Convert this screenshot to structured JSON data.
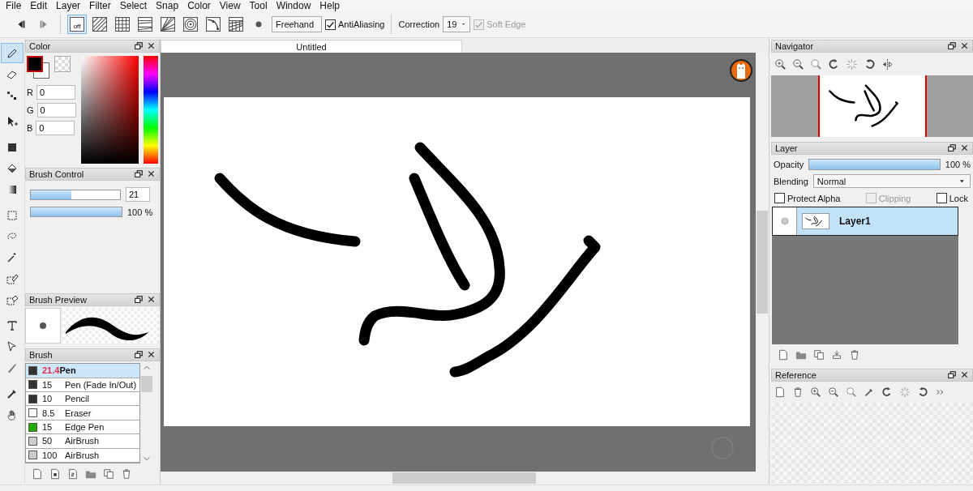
{
  "menu": [
    "File",
    "Edit",
    "Layer",
    "Filter",
    "Select",
    "Snap",
    "Color",
    "View",
    "Tool",
    "Window",
    "Help"
  ],
  "toolbar": {
    "snap_modes": [
      {
        "kind": "off",
        "label": "off",
        "selected": true
      },
      {
        "kind": "parallel",
        "selected": false
      },
      {
        "kind": "grid",
        "selected": false
      },
      {
        "kind": "lines",
        "selected": false
      },
      {
        "kind": "radial",
        "selected": false
      },
      {
        "kind": "concentric",
        "selected": false
      },
      {
        "kind": "curve",
        "selected": false
      },
      {
        "kind": "perspective",
        "selected": false
      }
    ],
    "stroke_mode": "Freehand",
    "antialiasing": {
      "label": "AntiAliasing",
      "checked": true
    },
    "correction": {
      "label": "Correction",
      "value": "19"
    },
    "soft_edge": {
      "label": "Soft Edge",
      "checked": true,
      "disabled": true
    }
  },
  "tools": [
    {
      "kind": "pen",
      "selected": true
    },
    {
      "kind": "eraser",
      "selected": false
    },
    {
      "kind": "dots",
      "selected": false
    },
    {
      "kind": "move",
      "selected": false
    },
    {
      "kind": "fill",
      "selected": false
    },
    {
      "kind": "bucket",
      "selected": false
    },
    {
      "kind": "gradient",
      "selected": false
    },
    {
      "kind": "select",
      "selected": false
    },
    {
      "kind": "lasso",
      "selected": false
    },
    {
      "kind": "wand",
      "selected": false
    },
    {
      "kind": "selpen",
      "selected": false
    },
    {
      "kind": "selerase",
      "selected": false
    },
    {
      "kind": "text",
      "selected": false
    },
    {
      "kind": "operation",
      "selected": false
    },
    {
      "kind": "divide",
      "selected": false
    },
    {
      "kind": "eyedropper",
      "selected": false
    },
    {
      "kind": "hand",
      "selected": false
    }
  ],
  "color_panel": {
    "title": "Color",
    "fields": [
      {
        "label": "R",
        "value": "0"
      },
      {
        "label": "G",
        "value": "0"
      },
      {
        "label": "B",
        "value": "0"
      }
    ]
  },
  "brush_control": {
    "title": "Brush Control",
    "size": {
      "level": 0.45,
      "value": "21"
    },
    "opacity": {
      "level": 1,
      "value": "100 %"
    }
  },
  "brush_preview": {
    "title": "Brush Preview"
  },
  "brush_panel": {
    "title": "Brush",
    "items": [
      {
        "size": "21.4",
        "name": "Pen",
        "color": "#333333",
        "selected": true
      },
      {
        "size": "15",
        "name": "Pen (Fade In/Out)",
        "color": "#333333",
        "selected": false
      },
      {
        "size": "10",
        "name": "Pencil",
        "color": "#333333",
        "selected": false
      },
      {
        "size": "8.5",
        "name": "Eraser",
        "color": "#ffffff",
        "selected": false
      },
      {
        "size": "15",
        "name": "Edge Pen",
        "color": "#22aa00",
        "selected": false
      },
      {
        "size": "50",
        "name": "AirBrush",
        "color": "#cccccc",
        "selected": false
      },
      {
        "size": "100",
        "name": "AirBrush",
        "color": "#cccccc",
        "selected": false
      }
    ]
  },
  "canvas": {
    "tab": "Untitled"
  },
  "navigator": {
    "title": "Navigator"
  },
  "layer_panel": {
    "title": "Layer",
    "opacity": {
      "label": "Opacity",
      "level": 1,
      "value": "100 %"
    },
    "blending_label": "Blending",
    "blending": "Normal",
    "options": [
      {
        "label": "Protect Alpha",
        "checked": false,
        "disabled": false
      },
      {
        "label": "Clipping",
        "checked": false,
        "disabled": true
      },
      {
        "label": "Lock",
        "checked": false,
        "disabled": false
      }
    ],
    "layers": [
      {
        "name": "Layer1",
        "selected": true
      }
    ]
  },
  "reference": {
    "title": "Reference"
  }
}
